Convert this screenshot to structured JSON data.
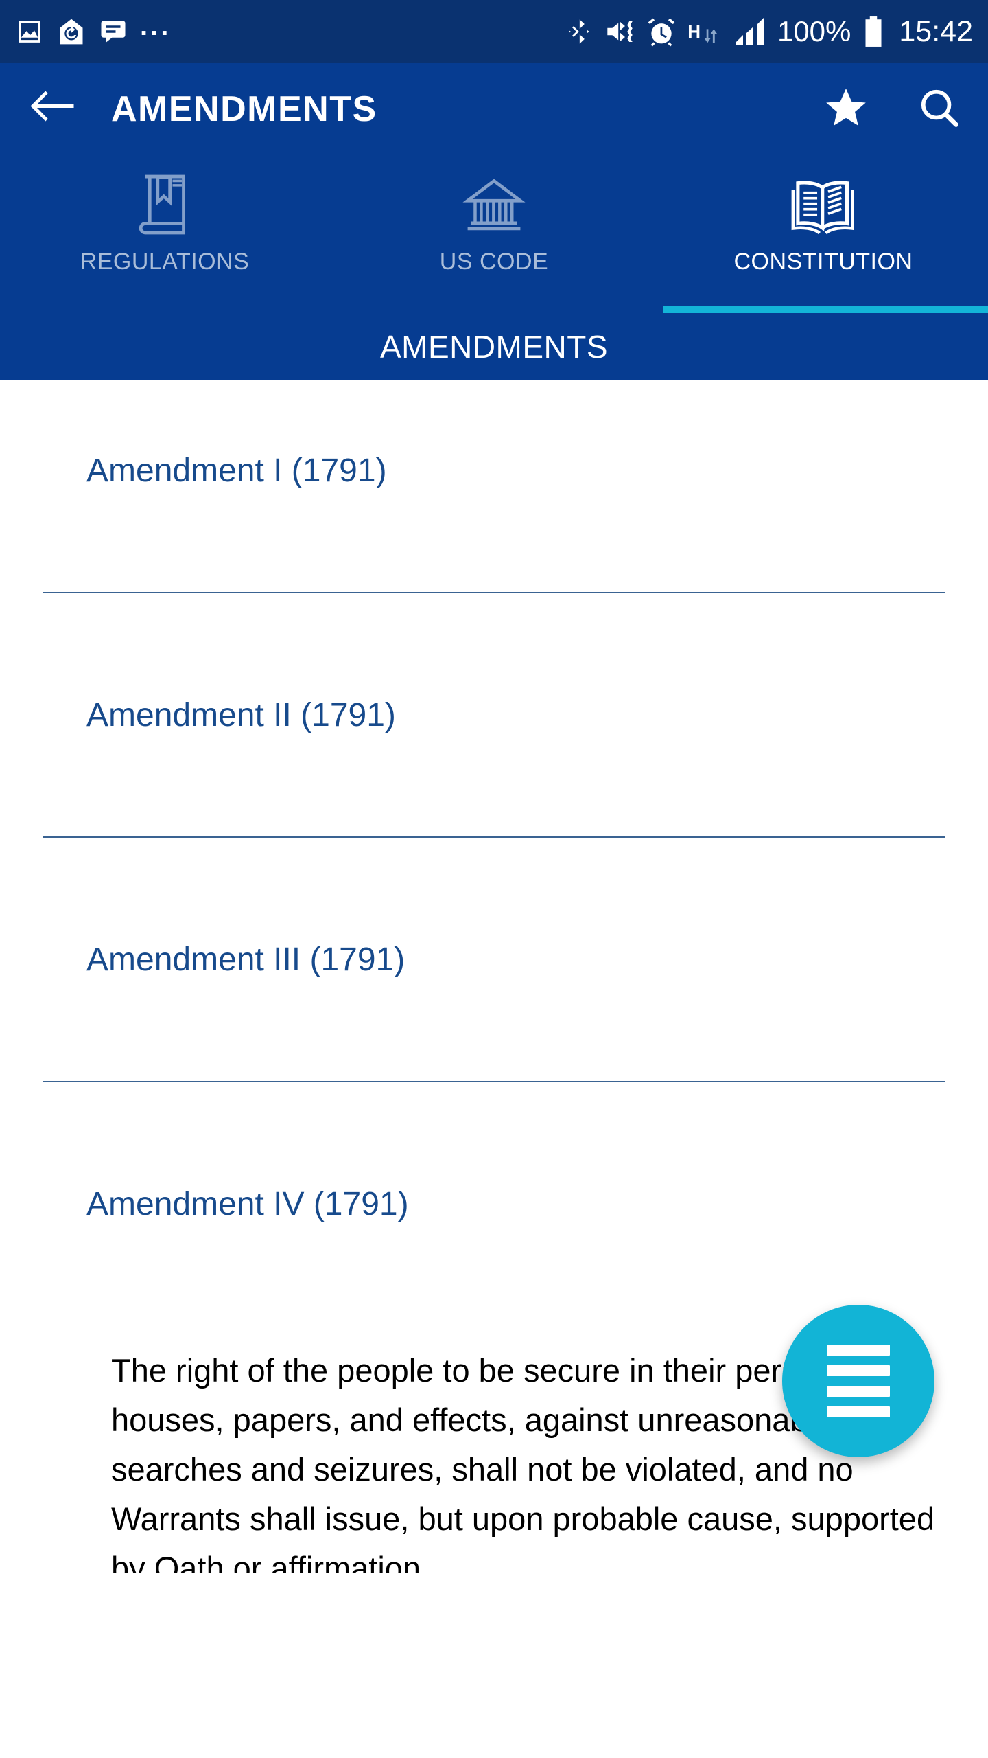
{
  "status_bar": {
    "left_icons": [
      "image-icon",
      "app-update-icon",
      "message-icon",
      "overflow-dots-icon"
    ],
    "overflow": "...",
    "right_icons": [
      "bluetooth-icon",
      "mute-vibrate-icon",
      "alarm-icon"
    ],
    "network_type": "H",
    "battery_percent": "100%",
    "time": "15:42"
  },
  "app_bar": {
    "back_icon": "back-arrow-icon",
    "title": "AMENDMENTS",
    "favorite_icon": "star-icon",
    "search_icon": "search-icon"
  },
  "tabs": [
    {
      "label": "REGULATIONS",
      "icon": "book-bookmark-icon",
      "active": false
    },
    {
      "label": "US CODE",
      "icon": "capitol-building-icon",
      "active": false
    },
    {
      "label": "CONSTITUTION",
      "icon": "open-book-icon",
      "active": true
    }
  ],
  "sub_header": {
    "title": "AMENDMENTS"
  },
  "list": [
    {
      "label": "Amendment I (1791)"
    },
    {
      "label": "Amendment II (1791)"
    },
    {
      "label": "Amendment III (1791)"
    },
    {
      "label": "Amendment IV (1791)"
    }
  ],
  "body": {
    "text": "The right of the people to be secure in their persons, houses, papers, and effects, against unreasonable searches and seizures, shall not be violated, and no Warrants shall issue, but upon probable cause, supported by Oath or affirmation,"
  },
  "fab": {
    "icon": "list-menu-icon",
    "label": ""
  },
  "colors": {
    "status_bar_bg": "#0a3270",
    "app_bar_bg": "#063c91",
    "accent_cyan": "#13b5d8",
    "link_blue": "#174a8c",
    "tab_inactive": "#a9bdd9",
    "divider": "#17487f",
    "body_text": "#000000",
    "page_bg": "#ffffff"
  }
}
